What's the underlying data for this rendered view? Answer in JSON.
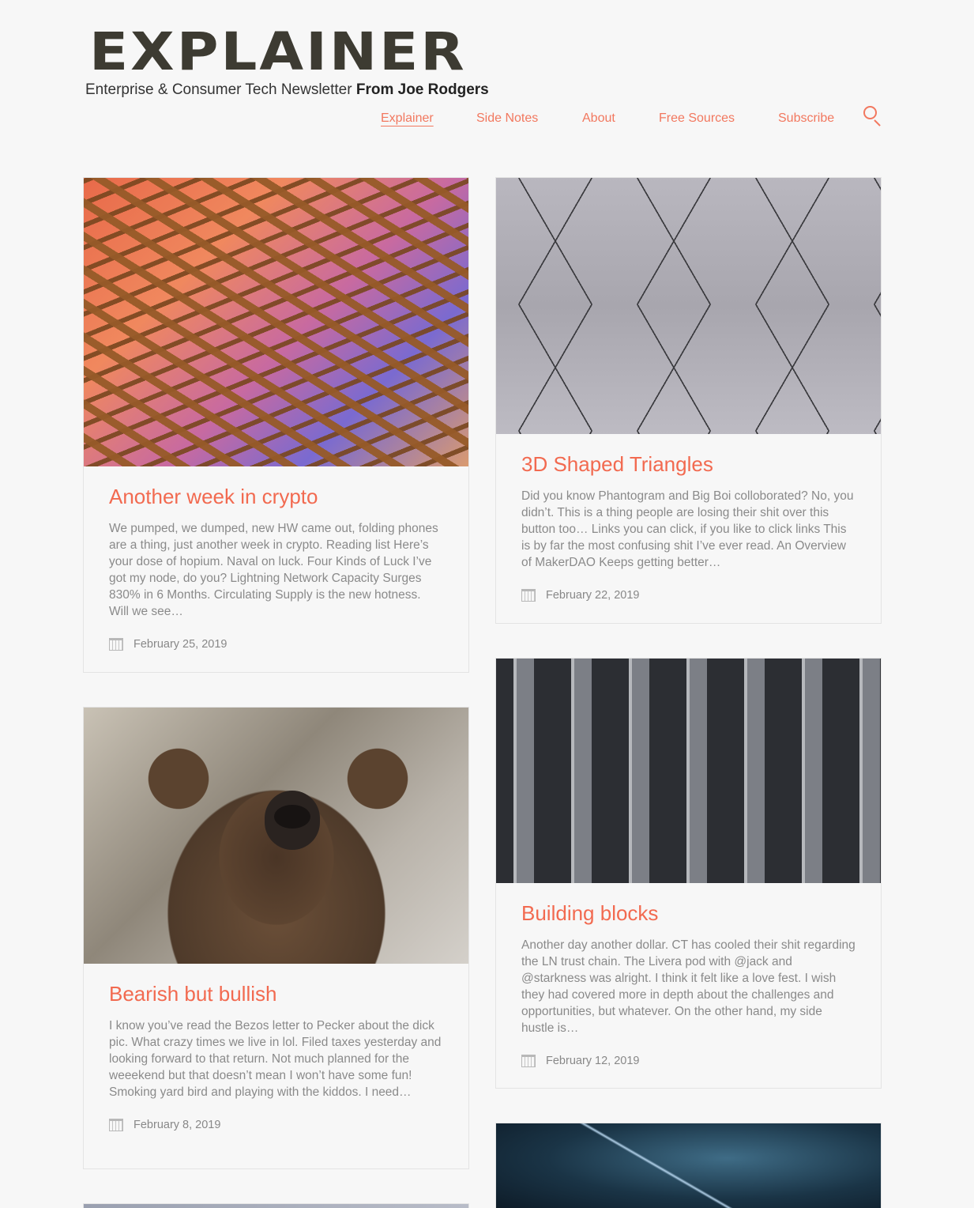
{
  "site": {
    "logo": "EXPLAINER",
    "tagline_prefix": "Enterprise & Consumer Tech Newsletter ",
    "tagline_author": "From Joe Rodgers"
  },
  "nav": {
    "items": [
      {
        "label": "Explainer",
        "active": true
      },
      {
        "label": "Side Notes",
        "active": false
      },
      {
        "label": "About",
        "active": false
      },
      {
        "label": "Free Sources",
        "active": false
      },
      {
        "label": "Subscribe",
        "active": false
      }
    ],
    "search_icon": "search-icon"
  },
  "colors": {
    "accent": "#f26a50",
    "nav": "#f2785f",
    "logo": "#3d3b32",
    "background": "#f7f7f7"
  },
  "posts": [
    {
      "title": "Another week in crypto",
      "excerpt": "We pumped, we dumped, new HW came out, folding phones are a thing, just another week in crypto. Reading list Here’s your dose of hopium. Naval on luck. Four Kinds of Luck I’ve got my node, do you? Lightning Network Capacity Surges 830% in 6 Months. Circulating Supply is the new hotness. Will we see…",
      "date": "February 25, 2019"
    },
    {
      "title": "3D Shaped Triangles",
      "excerpt": "  Did you know Phantogram and Big Boi colloborated? No, you didn’t.   This is a thing people are losing their shit over this button too…  Links you can click, if you like to click links This is by far the most confusing shit I’ve ever read. An Overview of MakerDAO Keeps getting better…",
      "date": "February 22, 2019"
    },
    {
      "title": "Bearish but bullish",
      "excerpt": "  I know you’ve read the Bezos letter to Pecker about the dick pic. What crazy times we live in lol. Filed taxes yesterday and looking forward to that return. Not much planned for the weeekend but that doesn’t mean I won’t have some fun! Smoking yard bird and playing with the kiddos. I need…",
      "date": "February 8, 2019"
    },
    {
      "title": "Building blocks",
      "excerpt": "  Another day another dollar. CT has cooled their shit regarding the LN trust chain. The Livera pod with @jack and @starkness was alright. I think it felt like a love fest. I wish they had covered more in depth about the challenges and opportunities, but whatever. On the other hand, my side hustle is…",
      "date": "February 12, 2019"
    }
  ]
}
